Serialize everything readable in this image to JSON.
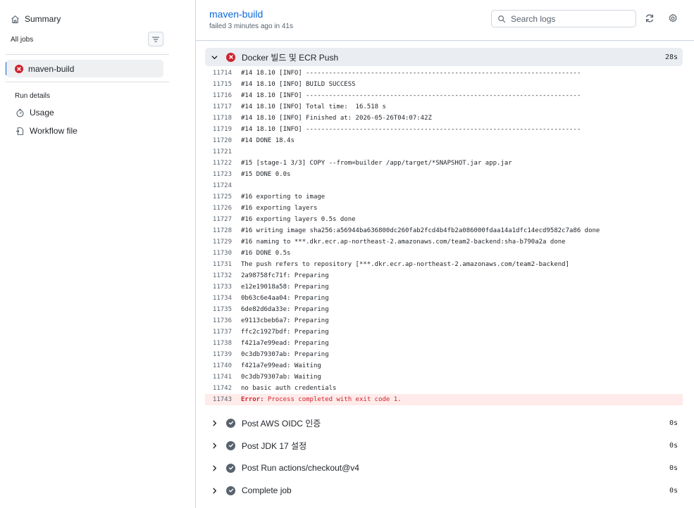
{
  "sidebar": {
    "summary_label": "Summary",
    "all_jobs_label": "All jobs",
    "jobs": [
      {
        "label": "maven-build",
        "status": "failed"
      }
    ],
    "run_details_label": "Run details",
    "run_details_items": [
      {
        "label": "Usage",
        "icon": "stopwatch-icon"
      },
      {
        "label": "Workflow file",
        "icon": "workflow-file-icon"
      }
    ]
  },
  "header": {
    "title": "maven-build",
    "subtitle": "failed 3 minutes ago in 41s",
    "search_placeholder": "Search logs"
  },
  "expanded_step": {
    "name": "Docker 빌드 및 ECR Push",
    "duration": "28s",
    "status": "failed"
  },
  "log_lines": [
    {
      "n": "11714",
      "text": "#14 18.10 [INFO] ------------------------------------------------------------------------"
    },
    {
      "n": "11715",
      "text": "#14 18.10 [INFO] BUILD SUCCESS"
    },
    {
      "n": "11716",
      "text": "#14 18.10 [INFO] ------------------------------------------------------------------------"
    },
    {
      "n": "11717",
      "text": "#14 18.10 [INFO] Total time:  16.518 s"
    },
    {
      "n": "11718",
      "text": "#14 18.10 [INFO] Finished at: 2026-05-26T04:07:42Z"
    },
    {
      "n": "11719",
      "text": "#14 18.10 [INFO] ------------------------------------------------------------------------"
    },
    {
      "n": "11720",
      "text": "#14 DONE 18.4s"
    },
    {
      "n": "11721",
      "text": ""
    },
    {
      "n": "11722",
      "text": "#15 [stage-1 3/3] COPY --from=builder /app/target/*SNAPSHOT.jar app.jar"
    },
    {
      "n": "11723",
      "text": "#15 DONE 0.0s"
    },
    {
      "n": "11724",
      "text": ""
    },
    {
      "n": "11725",
      "text": "#16 exporting to image"
    },
    {
      "n": "11726",
      "text": "#16 exporting layers"
    },
    {
      "n": "11727",
      "text": "#16 exporting layers 0.5s done"
    },
    {
      "n": "11728",
      "text": "#16 writing image sha256:a56944ba636800dc260fab2fcd4b4fb2a086000fdaa14a1dfc14ecd9582c7a86 done"
    },
    {
      "n": "11729",
      "text": "#16 naming to ***.dkr.ecr.ap-northeast-2.amazonaws.com/team2-backend:sha-b790a2a done"
    },
    {
      "n": "11730",
      "text": "#16 DONE 0.5s"
    },
    {
      "n": "11731",
      "text": "The push refers to repository [***.dkr.ecr.ap-northeast-2.amazonaws.com/team2-backend]"
    },
    {
      "n": "11732",
      "text": "2a98758fc71f: Preparing"
    },
    {
      "n": "11733",
      "text": "e12e19018a58: Preparing"
    },
    {
      "n": "11734",
      "text": "0b63c6e4aa04: Preparing"
    },
    {
      "n": "11735",
      "text": "6de82d6da33e: Preparing"
    },
    {
      "n": "11736",
      "text": "e9113cbeb6a7: Preparing"
    },
    {
      "n": "11737",
      "text": "ffc2c1927bdf: Preparing"
    },
    {
      "n": "11738",
      "text": "f421a7e99ead: Preparing"
    },
    {
      "n": "11739",
      "text": "0c3db79307ab: Preparing"
    },
    {
      "n": "11740",
      "text": "f421a7e99ead: Waiting"
    },
    {
      "n": "11741",
      "text": "0c3db79307ab: Waiting"
    },
    {
      "n": "11742",
      "text": "no basic auth credentials"
    }
  ],
  "error_line": {
    "n": "11743",
    "tag": "Error:",
    "message": " Process completed with exit code 1."
  },
  "collapsed_steps": [
    {
      "name": "Post AWS OIDC 인증",
      "duration": "0s",
      "status": "success"
    },
    {
      "name": "Post JDK 17 설정",
      "duration": "0s",
      "status": "success"
    },
    {
      "name": "Post Run actions/checkout@v4",
      "duration": "0s",
      "status": "success"
    },
    {
      "name": "Complete job",
      "duration": "0s",
      "status": "success"
    }
  ],
  "colors": {
    "accent": "#0969da",
    "error": "#cf222e",
    "error_bg": "#ffebe9",
    "success_gray": "#59636e"
  }
}
